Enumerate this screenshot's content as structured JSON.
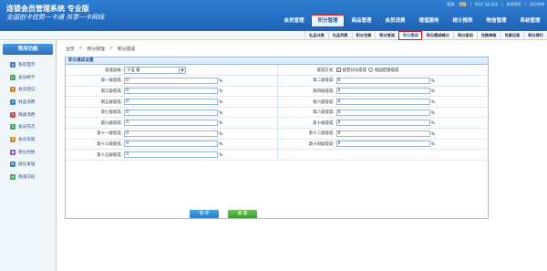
{
  "header": {
    "brand": "连锁会员管理系统 专业版",
    "slogan": "全国创卡优势一卡通 共享一卡网线",
    "top_links": [
      "管理:",
      "超管",
      "|",
      "所在门店:总店",
      "|",
      "修改密码",
      "|",
      "退出系统"
    ],
    "main_nav": [
      "会员管理",
      "积分管理",
      "商品管理",
      "会员消费",
      "增值服务",
      "统计报表",
      "物信管理",
      "系统管理"
    ],
    "active_main": "积分管理"
  },
  "sub_nav": {
    "items": [
      "礼品分类",
      "礼品列表",
      "积分兑换",
      "积分变动",
      "积分提成",
      "积分提成统计",
      "积分变动",
      "兑换审核",
      "兑换记录",
      "积分排行"
    ],
    "active": "积分提成"
  },
  "sidebar": {
    "title": "常用功能",
    "items": [
      {
        "label": "系统首页",
        "icon": "home-icon",
        "color": "#3b82c4"
      },
      {
        "label": "会员刷卡",
        "icon": "card-icon",
        "color": "#4aa35a"
      },
      {
        "label": "会员登记",
        "icon": "user-add-icon",
        "color": "#d48a2c"
      },
      {
        "label": "商品消费",
        "icon": "cart-icon",
        "color": "#3b82c4"
      },
      {
        "label": "快速消费",
        "icon": "lightning-icon",
        "color": "#c74848"
      },
      {
        "label": "会员充次",
        "icon": "recharge-icon",
        "color": "#4aa35a"
      },
      {
        "label": "会员充值",
        "icon": "money-icon",
        "color": "#d48a2c"
      },
      {
        "label": "积分兑换",
        "icon": "gift-icon",
        "color": "#8a58c4"
      },
      {
        "label": "短信发送",
        "icon": "sms-icon",
        "color": "#3b82c4"
      },
      {
        "label": "快速交班",
        "icon": "handover-icon",
        "color": "#4aa35a"
      }
    ]
  },
  "breadcrumb": [
    "主页",
    "积分管理",
    "积分提成"
  ],
  "panel": {
    "title": "积分提成设置",
    "level_label": "提成层级:",
    "level_value": "十五 级",
    "method_label": "提成方式:",
    "method_options": [
      "按百分比提成",
      "按固定值提成"
    ],
    "rows": [
      [
        "第一级提成:",
        "第二级提成:"
      ],
      [
        "第三级提成:",
        "第四级提成:"
      ],
      [
        "第五级提成:",
        "第六级提成:"
      ],
      [
        "第七级提成:",
        "第八级提成:"
      ],
      [
        "第九级提成:",
        "第十级提成:"
      ],
      [
        "第十一级提成:",
        "第十二级提成:"
      ],
      [
        "第十三级提成:",
        "第十四级提成:"
      ],
      [
        "第十五级提成:",
        ""
      ]
    ],
    "default_value": "0",
    "unit": "%",
    "save_label": "保 存",
    "reset_label": "重 置"
  }
}
